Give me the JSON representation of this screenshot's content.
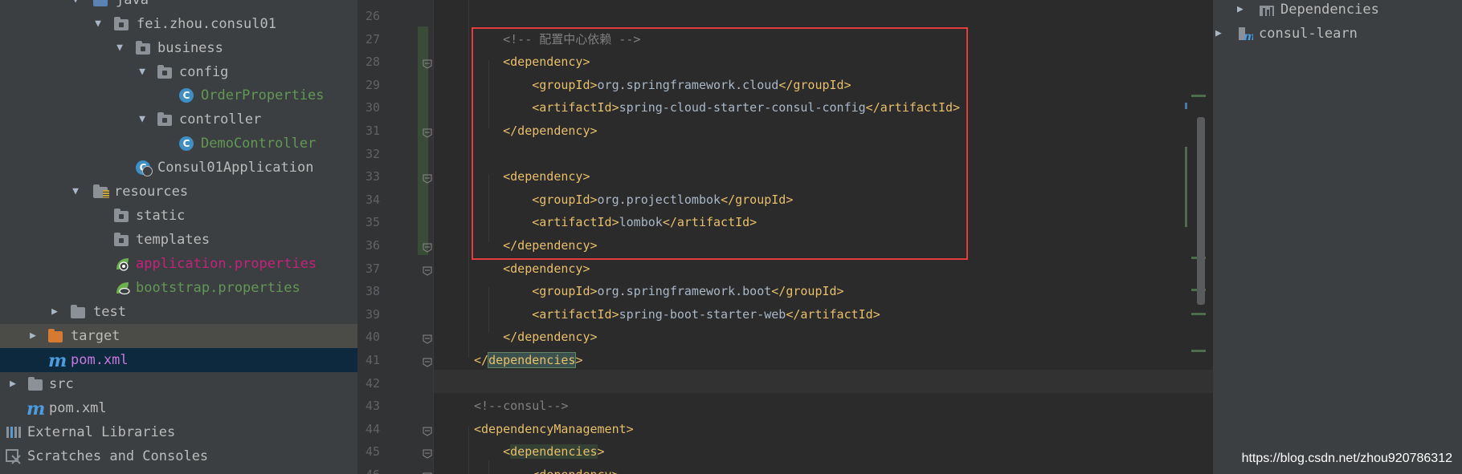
{
  "project_tree": {
    "items": [
      {
        "label": "java",
        "kind": "folder-src",
        "expanded": true
      },
      {
        "label": "fei.zhou.consul01",
        "kind": "package",
        "expanded": true
      },
      {
        "label": "business",
        "kind": "package",
        "expanded": true
      },
      {
        "label": "config",
        "kind": "package",
        "expanded": true
      },
      {
        "label": "OrderProperties",
        "kind": "class"
      },
      {
        "label": "controller",
        "kind": "package",
        "expanded": true
      },
      {
        "label": "DemoController",
        "kind": "class"
      },
      {
        "label": "Consul01Application",
        "kind": "spring-boot-class"
      },
      {
        "label": "resources",
        "kind": "folder-res",
        "expanded": true
      },
      {
        "label": "static",
        "kind": "folder"
      },
      {
        "label": "templates",
        "kind": "folder"
      },
      {
        "label": "application.properties",
        "kind": "spring-properties"
      },
      {
        "label": "bootstrap.properties",
        "kind": "spring-properties"
      },
      {
        "label": "test",
        "kind": "folder",
        "expanded": false
      },
      {
        "label": "target",
        "kind": "folder-excluded",
        "expanded": false
      },
      {
        "label": "pom.xml",
        "kind": "maven"
      },
      {
        "label": "src",
        "kind": "folder",
        "expanded": false
      },
      {
        "label": "pom.xml",
        "kind": "maven"
      },
      {
        "label": "External Libraries",
        "kind": "libraries"
      },
      {
        "label": "Scratches and Consoles",
        "kind": "scratches"
      }
    ]
  },
  "editor": {
    "lines": [
      {
        "num": "26",
        "parts": []
      },
      {
        "num": "27",
        "parts": [
          {
            "cls": "cm",
            "text": "    <!-- 配置中心依赖 -->"
          }
        ]
      },
      {
        "num": "28",
        "parts": [
          {
            "cls": "t",
            "text": "    <dependency>"
          }
        ]
      },
      {
        "num": "29",
        "parts": [
          {
            "cls": "t",
            "text": "        <groupId>"
          },
          {
            "cls": "b",
            "text": "org.springframework.cloud"
          },
          {
            "cls": "t",
            "text": "</groupId>"
          }
        ]
      },
      {
        "num": "30",
        "parts": [
          {
            "cls": "t",
            "text": "        <artifactId>"
          },
          {
            "cls": "b",
            "text": "spring-cloud-starter-consul-config"
          },
          {
            "cls": "t",
            "text": "</artifactId>"
          }
        ]
      },
      {
        "num": "31",
        "parts": [
          {
            "cls": "t",
            "text": "    </dependency>"
          }
        ]
      },
      {
        "num": "32",
        "parts": []
      },
      {
        "num": "33",
        "parts": [
          {
            "cls": "t",
            "text": "    <dependency>"
          }
        ]
      },
      {
        "num": "34",
        "parts": [
          {
            "cls": "t",
            "text": "        <groupId>"
          },
          {
            "cls": "b",
            "text": "org.projectlombok"
          },
          {
            "cls": "t",
            "text": "</groupId>"
          }
        ]
      },
      {
        "num": "35",
        "parts": [
          {
            "cls": "t",
            "text": "        <artifactId>"
          },
          {
            "cls": "b",
            "text": "lombok"
          },
          {
            "cls": "t",
            "text": "</artifactId>"
          }
        ]
      },
      {
        "num": "36",
        "parts": [
          {
            "cls": "t",
            "text": "    </dependency>"
          }
        ]
      },
      {
        "num": "37",
        "parts": [
          {
            "cls": "t",
            "text": "    <dependency>"
          }
        ]
      },
      {
        "num": "38",
        "parts": [
          {
            "cls": "t",
            "text": "        <groupId>"
          },
          {
            "cls": "b",
            "text": "org.springframework.boot"
          },
          {
            "cls": "t",
            "text": "</groupId>"
          }
        ]
      },
      {
        "num": "39",
        "parts": [
          {
            "cls": "t",
            "text": "        <artifactId>"
          },
          {
            "cls": "b",
            "text": "spring-boot-starter-web"
          },
          {
            "cls": "t",
            "text": "</artifactId>"
          }
        ]
      },
      {
        "num": "40",
        "parts": [
          {
            "cls": "t",
            "text": "    </dependency>"
          }
        ]
      },
      {
        "num": "41",
        "parts": [
          {
            "cls": "t",
            "text": "</"
          },
          {
            "cls": "t hl",
            "text": "dependencies"
          },
          {
            "cls": "t",
            "text": ">"
          }
        ]
      },
      {
        "num": "42",
        "parts": []
      },
      {
        "num": "43",
        "parts": [
          {
            "cls": "cm",
            "text": "<!--consul-->"
          }
        ]
      },
      {
        "num": "44",
        "parts": [
          {
            "cls": "t",
            "text": "<dependencyManagement>"
          }
        ]
      },
      {
        "num": "45",
        "parts": [
          {
            "cls": "t",
            "text": "    <"
          },
          {
            "cls": "t hl2",
            "text": "dependencies"
          },
          {
            "cls": "t",
            "text": ">"
          }
        ]
      },
      {
        "num": "46",
        "parts": [
          {
            "cls": "t",
            "text": "        <dependency>"
          }
        ]
      }
    ]
  },
  "maven_panel": {
    "items": [
      {
        "label": "Dependencies"
      },
      {
        "label": "consul-learn"
      }
    ]
  },
  "watermark": "https://blog.csdn.net/zhou920786312",
  "colors": {
    "tag": "#e8bf6a",
    "text": "#a9b7c6",
    "comment": "#808080",
    "highlight_box": "#e43d3d"
  }
}
